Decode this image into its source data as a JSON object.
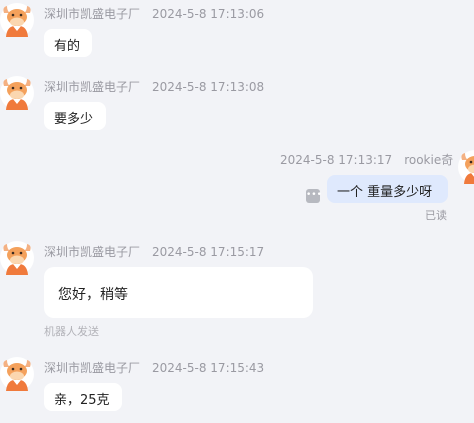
{
  "messages": [
    {
      "sender": "深圳市凯盛电子厂",
      "time": "2024-5-8 17:13:06",
      "text": "有的"
    },
    {
      "sender": "深圳市凯盛电子厂",
      "time": "2024-5-8 17:13:08",
      "text": "要多少"
    },
    {
      "sender": "rookie奇",
      "time": "2024-5-8 17:13:17",
      "text": "一个  重量多少呀",
      "status": "已读"
    },
    {
      "sender": "深圳市凯盛电子厂",
      "time": "2024-5-8 17:15:17",
      "text": "您好，稍等",
      "note": "机器人发送"
    },
    {
      "sender": "深圳市凯盛电子厂",
      "time": "2024-5-8 17:15:43",
      "text": "亲，25克"
    }
  ],
  "icons": {
    "avatar": "cartoon-bull-avatar-icon",
    "more": "more-options-icon"
  },
  "colors": {
    "background": "#f2f3f7",
    "bubble_incoming": "#ffffff",
    "bubble_outgoing": "#dfe9fd",
    "avatar_accent": "#f07a3c"
  }
}
